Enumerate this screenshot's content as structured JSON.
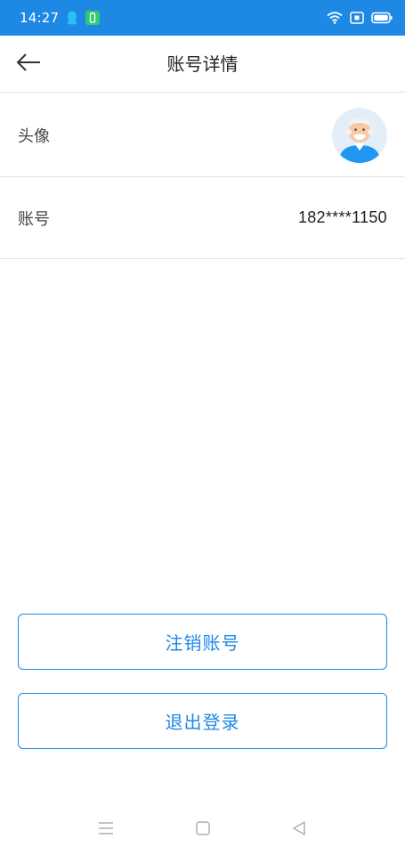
{
  "colors": {
    "accent": "#1e88e5",
    "qq_badge": "#27c1f5",
    "battery_badge": "#2ecc71"
  },
  "status_bar": {
    "time": "14:27",
    "icons": [
      "qq-icon",
      "battery-saver-icon",
      "wifi-icon",
      "sim-card-icon",
      "battery-icon"
    ]
  },
  "header": {
    "back_icon": "arrow-left-icon",
    "title": "账号详情"
  },
  "rows": {
    "avatar": {
      "label": "头像"
    },
    "account": {
      "label": "账号",
      "value": "182****1150"
    }
  },
  "buttons": {
    "deactivate": "注销账号",
    "logout": "退出登录"
  },
  "nav_bar": {
    "icons": [
      "menu-icon",
      "home-icon",
      "back-triangle-icon"
    ]
  }
}
